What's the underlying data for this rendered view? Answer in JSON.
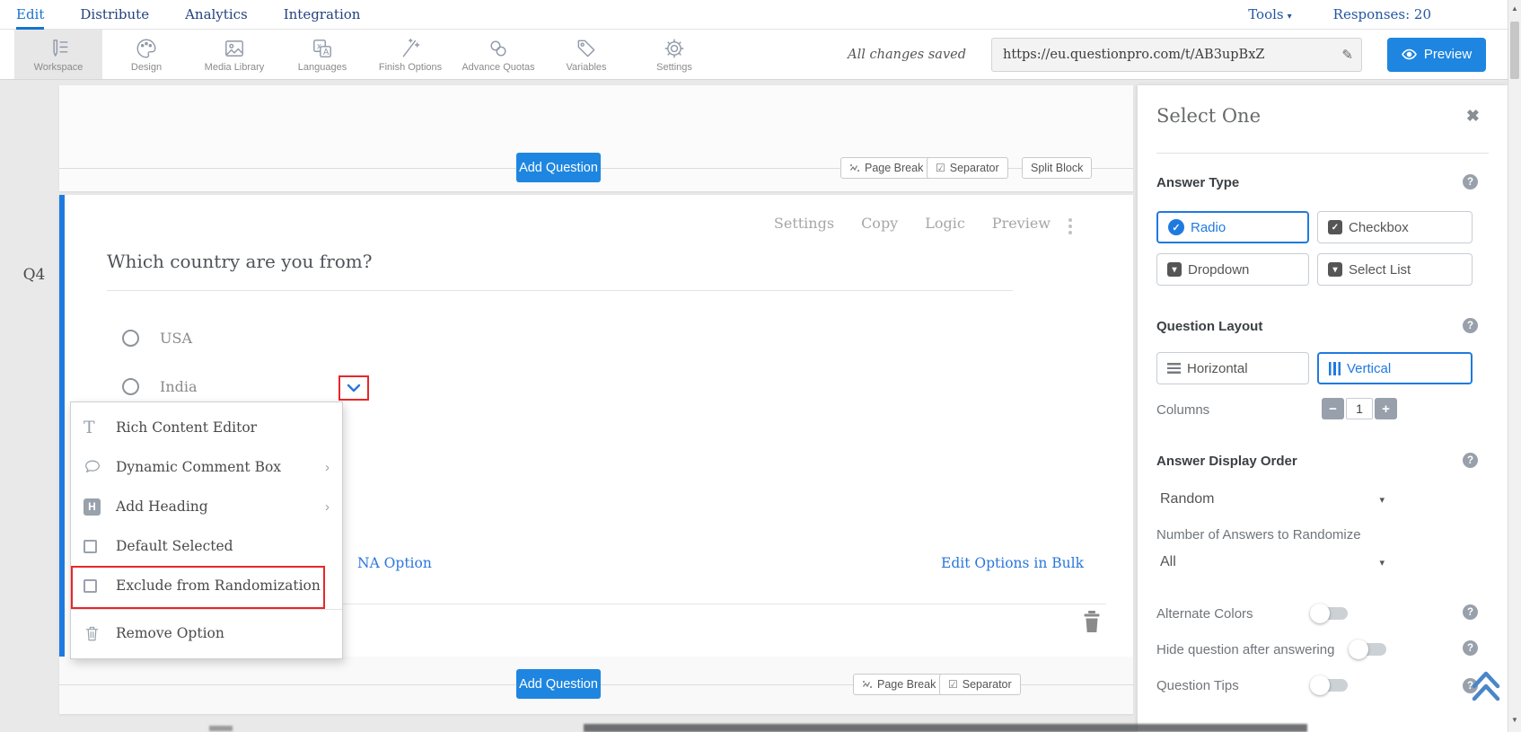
{
  "nav": {
    "items": [
      {
        "label": "Edit",
        "active": true
      },
      {
        "label": "Distribute",
        "active": false
      },
      {
        "label": "Analytics",
        "active": false
      },
      {
        "label": "Integration",
        "active": false
      }
    ],
    "tools": "Tools",
    "responses": "Responses: 20"
  },
  "toolbar": {
    "tabs": [
      {
        "label": "Workspace",
        "icon": "workspace-pen-list-icon",
        "active": true
      },
      {
        "label": "Design",
        "icon": "palette-icon",
        "active": false
      },
      {
        "label": "Media Library",
        "icon": "image-icon",
        "active": false
      },
      {
        "label": "Languages",
        "icon": "translate-icon",
        "active": false
      },
      {
        "label": "Finish Options",
        "icon": "magic-wand-icon",
        "active": false
      },
      {
        "label": "Advance Quotas",
        "icon": "chain-links-icon",
        "active": false
      },
      {
        "label": "Variables",
        "icon": "tag-icon",
        "active": false
      },
      {
        "label": "Settings",
        "icon": "gear-icon",
        "active": false
      }
    ],
    "saved": "All changes saved",
    "url": "https://eu.questionpro.com/t/AB3upBxZ",
    "preview": "Preview"
  },
  "strips": {
    "top": {
      "add_question": "Add Question",
      "page_break": "Page Break",
      "separator": "Separator",
      "split_block": "Split Block"
    },
    "bottom": {
      "add_question": "Add Question",
      "page_break": "Page Break",
      "separator": "Separator"
    }
  },
  "question": {
    "id": "Q4",
    "title": "Which country are you from?",
    "actions": [
      "Settings",
      "Copy",
      "Logic",
      "Preview"
    ],
    "options": [
      "USA",
      "India"
    ],
    "na_option": "NA Option",
    "edit_bulk": "Edit Options in Bulk"
  },
  "menu": {
    "items": [
      {
        "label": "Rich Content Editor",
        "icon": "text-icon",
        "icon_char": "T"
      },
      {
        "label": "Dynamic Comment Box",
        "icon": "comment-icon",
        "submenu": true
      },
      {
        "label": "Add Heading",
        "icon": "heading-icon",
        "icon_char": "H",
        "submenu": true
      },
      {
        "label": "Default Selected",
        "icon": "checkbox-icon"
      },
      {
        "label": "Exclude from Randomization",
        "icon": "checkbox-icon",
        "highlighted": true
      },
      {
        "label": "Remove Option",
        "icon": "trash-icon"
      }
    ],
    "submenu_caret": "›"
  },
  "panel": {
    "title": "Select One",
    "answer_type": {
      "label": "Answer Type",
      "options": [
        "Radio",
        "Checkbox",
        "Dropdown",
        "Select List"
      ],
      "selected": "Radio"
    },
    "layout": {
      "label": "Question Layout",
      "options": [
        "Horizontal",
        "Vertical"
      ],
      "selected": "Vertical"
    },
    "columns": {
      "label": "Columns",
      "value": "1",
      "minus": "−",
      "plus": "+"
    },
    "display_order": {
      "label": "Answer Display Order",
      "value": "Random",
      "sub_label": "Number of Answers to Randomize",
      "sub_value": "All"
    },
    "toggles": [
      {
        "label": "Alternate Colors",
        "on": false
      },
      {
        "label": "Hide question after answering",
        "on": false
      },
      {
        "label": "Question Tips",
        "on": false
      }
    ]
  },
  "icons": {
    "close": "✖",
    "help": "?",
    "caret_down": "▾",
    "check": "✓",
    "pencil": "✎",
    "separator_check": "☑",
    "scroll_up": "▲",
    "scroll_down": "▼"
  },
  "colors": {
    "primary_blue": "#1e86e0",
    "selected_blue": "#1f7ae0",
    "link_blue": "#2a76dd",
    "highlight_red": "#e8262a",
    "nav_navy": "#24427e",
    "page_bg": "#e9e9e9"
  }
}
